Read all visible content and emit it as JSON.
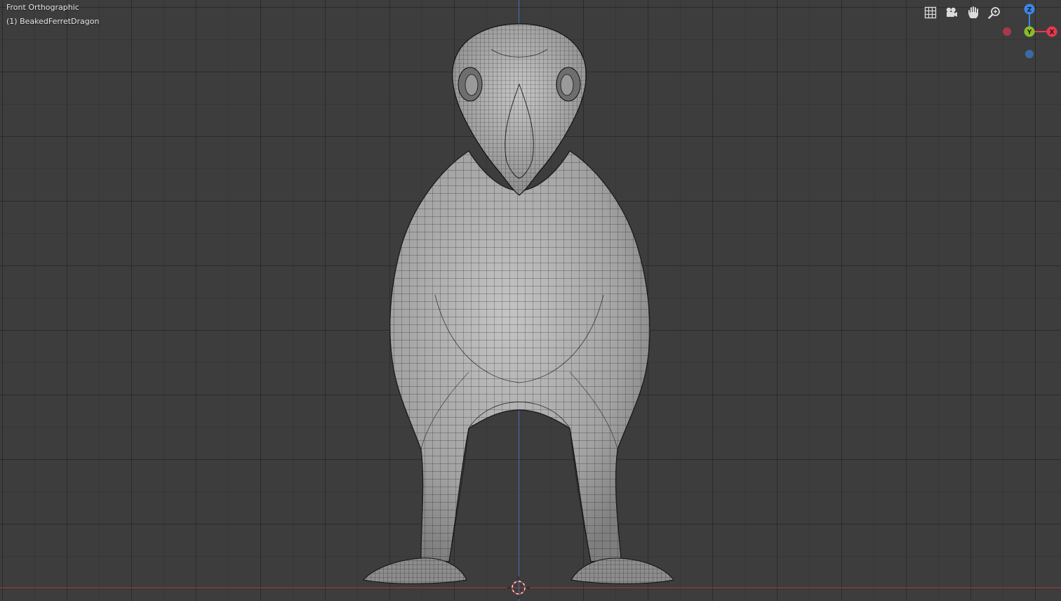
{
  "viewport": {
    "view_name": "Front Orthographic",
    "object_name": "(1) BeakedFerretDragon"
  },
  "nav_controls": [
    {
      "name": "toggle-grid-button",
      "icon": "grid-icon"
    },
    {
      "name": "camera-view-button",
      "icon": "camera-icon"
    },
    {
      "name": "pan-view-button",
      "icon": "hand-icon"
    },
    {
      "name": "zoom-view-button",
      "icon": "zoom-icon"
    }
  ],
  "gizmo": {
    "z_label": "Z",
    "y_label": "Y",
    "x_label": "X",
    "colors": {
      "x": "#e8384f",
      "y": "#8bbd28",
      "z": "#3b86e8",
      "neg_x": "#a6394a",
      "neg_z": "#3a6aa6"
    }
  },
  "colors": {
    "background": "#3d3d3d",
    "mesh_fill": "#a9a9a9",
    "mesh_wire": "#1e1e1e",
    "axis_x": "#c0434f",
    "axis_z": "#4a7fc0"
  }
}
